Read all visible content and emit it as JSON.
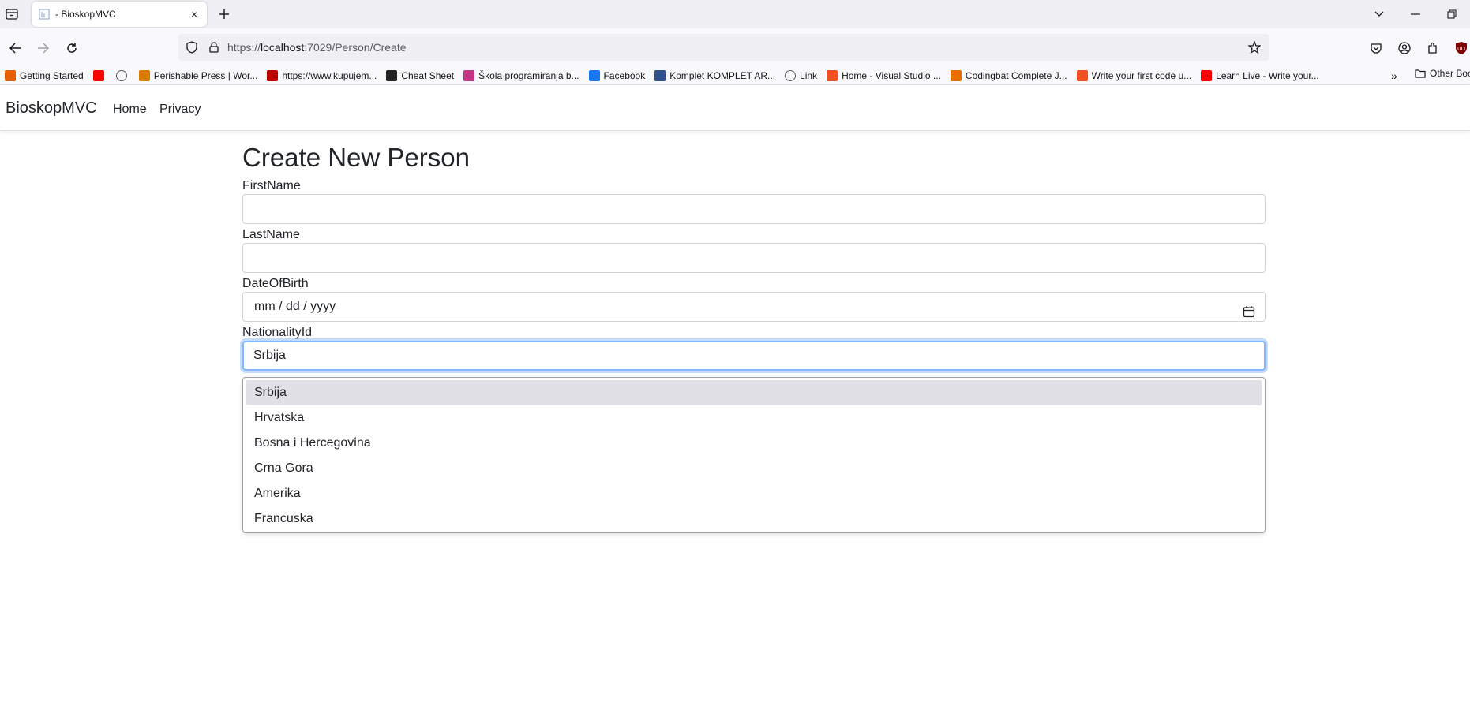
{
  "browser": {
    "tab_title": "- BioskopMVC",
    "tab_close": "×",
    "url_prefix": "https://",
    "url_host": "localhost",
    "url_rest": ":7029/Person/Create",
    "bookmarks": [
      {
        "label": "Getting Started",
        "icon": "firefox-icon",
        "color": "#e66000"
      },
      {
        "label": "",
        "icon": "youtube-icon",
        "color": "#ff0000"
      },
      {
        "label": "",
        "icon": "globe-icon",
        "color": "#5b5b66"
      },
      {
        "label": "Perishable Press | Wor...",
        "icon": "sun-icon",
        "color": "#d97a00"
      },
      {
        "label": "https://www.kupujem...",
        "icon": "kp-icon",
        "color": "#c00000"
      },
      {
        "label": "Cheat Sheet",
        "icon": "leaf-icon",
        "color": "#222222"
      },
      {
        "label": "Škola programiranja b...",
        "icon": "instagram-icon",
        "color": "#c13584"
      },
      {
        "label": "Facebook",
        "icon": "facebook-icon",
        "color": "#1877f2"
      },
      {
        "label": "Komplet KOMPLET AR...",
        "icon": "k-icon",
        "color": "#2f4f8f"
      },
      {
        "label": "Link",
        "icon": "globe-icon",
        "color": "#5b5b66"
      },
      {
        "label": "Home - Visual Studio ...",
        "icon": "microsoft-icon",
        "color": "#f25022"
      },
      {
        "label": "Codingbat Complete J...",
        "icon": "java-icon",
        "color": "#e76f00"
      },
      {
        "label": "Write your first code u...",
        "icon": "microsoft-icon",
        "color": "#f25022"
      },
      {
        "label": "Learn Live - Write your...",
        "icon": "youtube-icon",
        "color": "#ff0000"
      }
    ],
    "other_bookmarks": "Other Boo"
  },
  "app": {
    "brand": "BioskopMVC",
    "nav": [
      "Home",
      "Privacy"
    ]
  },
  "form": {
    "title": "Create New Person",
    "first_name_label": "FirstName",
    "first_name_value": "",
    "last_name_label": "LastName",
    "last_name_value": "",
    "dob_label": "DateOfBirth",
    "dob_placeholder": "mm / dd / yyyy",
    "nationality_label": "NationalityId",
    "nationality_selected": "Srbija",
    "nationality_options": [
      "Srbija",
      "Hrvatska",
      "Bosna i Hercegovina",
      "Crna Gora",
      "Amerika",
      "Francuska"
    ]
  }
}
